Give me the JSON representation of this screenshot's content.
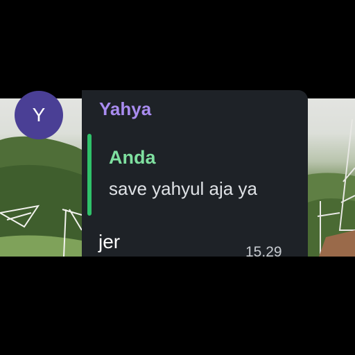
{
  "message": {
    "sender_name": "Yahya",
    "avatar_initial": "Y",
    "reply": {
      "author": "Anda",
      "text": "save yahyul aja ya"
    },
    "text": "jer",
    "time": "15.29"
  },
  "colors": {
    "avatar_bg": "#4a3f95",
    "sender_name": "#a98cf0",
    "bubble_bg": "#1e2227",
    "reply_bar": "#2fc26a",
    "reply_author": "#7fe0a0"
  }
}
